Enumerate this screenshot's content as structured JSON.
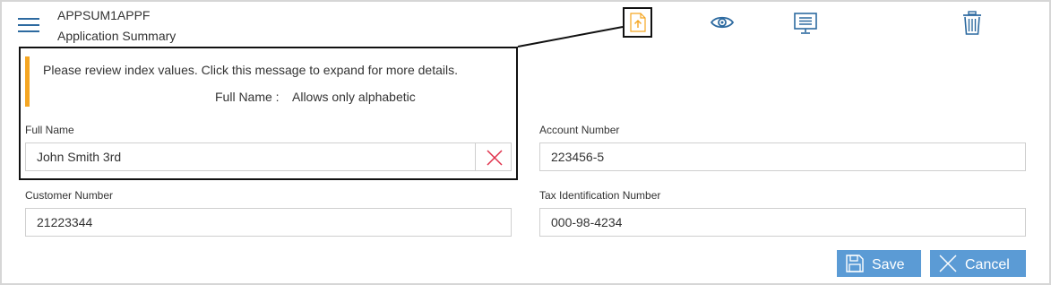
{
  "header": {
    "document_id": "APPSUM1APPF",
    "document_type": "Application Summary"
  },
  "toolbar": {
    "icons": [
      "menu-icon",
      "upload-document-icon",
      "view-icon",
      "monitor-icon",
      "trash-icon"
    ]
  },
  "validation": {
    "message": "Please review index values. Click this message to expand for more details.",
    "field": "Full Name :",
    "rule": "Allows only alphabetic",
    "accent_color": "#f5a623"
  },
  "fields": {
    "full_name": {
      "label": "Full Name",
      "value": "John Smith 3rd"
    },
    "account_number": {
      "label": "Account Number",
      "value": "223456-5"
    },
    "customer_number": {
      "label": "Customer Number",
      "value": "21223344"
    },
    "tax_id": {
      "label": "Tax Identification Number",
      "value": "000-98-4234"
    }
  },
  "actions": {
    "save_label": "Save",
    "cancel_label": "Cancel",
    "button_color": "#5b9bd5"
  },
  "colors": {
    "icon_blue": "#2d6aa0",
    "clear_red": "#e0304a",
    "upload_orange": "#f5a623"
  }
}
